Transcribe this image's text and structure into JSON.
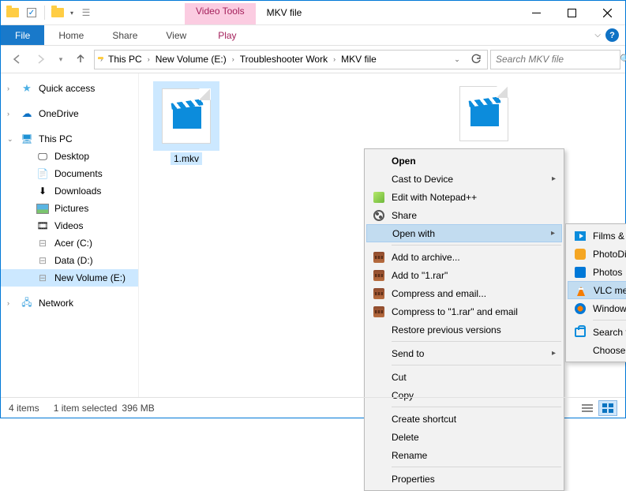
{
  "window": {
    "tool_tab_label": "Video Tools",
    "title": "MKV file"
  },
  "ribbon": {
    "file": "File",
    "home": "Home",
    "share": "Share",
    "view": "View",
    "play": "Play"
  },
  "breadcrumbs": [
    "This PC",
    "New Volume (E:)",
    "Troubleshooter Work",
    "MKV file"
  ],
  "search": {
    "placeholder": "Search MKV file"
  },
  "nav": {
    "quick": "Quick access",
    "onedrive": "OneDrive",
    "thispc": "This PC",
    "desktop": "Desktop",
    "documents": "Documents",
    "downloads": "Downloads",
    "pictures": "Pictures",
    "videos": "Videos",
    "acer": "Acer (C:)",
    "data": "Data (D:)",
    "newvol": "New Volume (E:)",
    "network": "Network"
  },
  "files": {
    "f1": "1.mkv"
  },
  "context_menu": {
    "open": "Open",
    "cast": "Cast to Device",
    "npp": "Edit with Notepad++",
    "share": "Share",
    "openwith": "Open with",
    "addarch": "Add to archive...",
    "addrar": "Add to \"1.rar\"",
    "compemail": "Compress and email...",
    "compraremail": "Compress to \"1.rar\" and email",
    "restore": "Restore previous versions",
    "sendto": "Send to",
    "cut": "Cut",
    "copy": "Copy",
    "shortcut": "Create shortcut",
    "delete": "Delete",
    "rename": "Rename",
    "props": "Properties"
  },
  "openwith_submenu": {
    "films": "Films & TV",
    "photodir": "PhotoDirector for acer",
    "photos": "Photos",
    "vlc": "VLC media player",
    "wmp": "Windows Media Player",
    "store": "Search the Store",
    "choose": "Choose another app"
  },
  "status": {
    "items": "4 items",
    "selected": "1 item selected",
    "size": "396 MB"
  }
}
